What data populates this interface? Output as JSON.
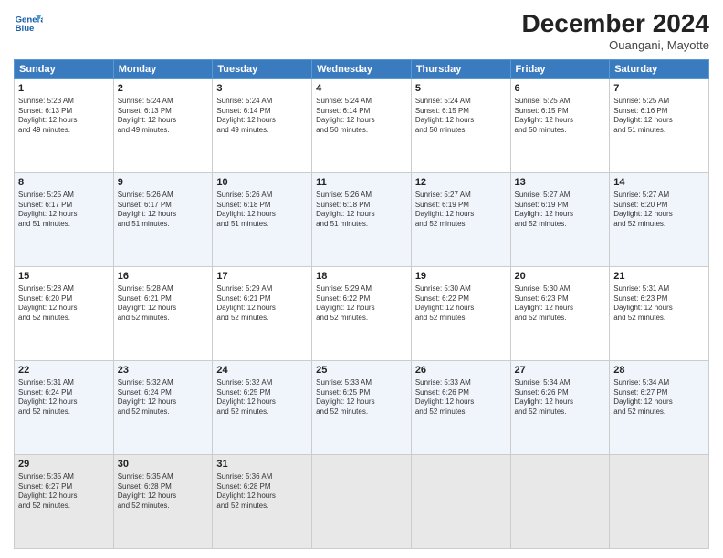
{
  "header": {
    "logo_line1": "General",
    "logo_line2": "Blue",
    "month": "December 2024",
    "location": "Ouangani, Mayotte"
  },
  "days_of_week": [
    "Sunday",
    "Monday",
    "Tuesday",
    "Wednesday",
    "Thursday",
    "Friday",
    "Saturday"
  ],
  "weeks": [
    [
      {
        "day": "1",
        "info": "Sunrise: 5:23 AM\nSunset: 6:13 PM\nDaylight: 12 hours\nand 49 minutes."
      },
      {
        "day": "2",
        "info": "Sunrise: 5:24 AM\nSunset: 6:13 PM\nDaylight: 12 hours\nand 49 minutes."
      },
      {
        "day": "3",
        "info": "Sunrise: 5:24 AM\nSunset: 6:14 PM\nDaylight: 12 hours\nand 49 minutes."
      },
      {
        "day": "4",
        "info": "Sunrise: 5:24 AM\nSunset: 6:14 PM\nDaylight: 12 hours\nand 50 minutes."
      },
      {
        "day": "5",
        "info": "Sunrise: 5:24 AM\nSunset: 6:15 PM\nDaylight: 12 hours\nand 50 minutes."
      },
      {
        "day": "6",
        "info": "Sunrise: 5:25 AM\nSunset: 6:15 PM\nDaylight: 12 hours\nand 50 minutes."
      },
      {
        "day": "7",
        "info": "Sunrise: 5:25 AM\nSunset: 6:16 PM\nDaylight: 12 hours\nand 51 minutes."
      }
    ],
    [
      {
        "day": "8",
        "info": "Sunrise: 5:25 AM\nSunset: 6:17 PM\nDaylight: 12 hours\nand 51 minutes."
      },
      {
        "day": "9",
        "info": "Sunrise: 5:26 AM\nSunset: 6:17 PM\nDaylight: 12 hours\nand 51 minutes."
      },
      {
        "day": "10",
        "info": "Sunrise: 5:26 AM\nSunset: 6:18 PM\nDaylight: 12 hours\nand 51 minutes."
      },
      {
        "day": "11",
        "info": "Sunrise: 5:26 AM\nSunset: 6:18 PM\nDaylight: 12 hours\nand 51 minutes."
      },
      {
        "day": "12",
        "info": "Sunrise: 5:27 AM\nSunset: 6:19 PM\nDaylight: 12 hours\nand 52 minutes."
      },
      {
        "day": "13",
        "info": "Sunrise: 5:27 AM\nSunset: 6:19 PM\nDaylight: 12 hours\nand 52 minutes."
      },
      {
        "day": "14",
        "info": "Sunrise: 5:27 AM\nSunset: 6:20 PM\nDaylight: 12 hours\nand 52 minutes."
      }
    ],
    [
      {
        "day": "15",
        "info": "Sunrise: 5:28 AM\nSunset: 6:20 PM\nDaylight: 12 hours\nand 52 minutes."
      },
      {
        "day": "16",
        "info": "Sunrise: 5:28 AM\nSunset: 6:21 PM\nDaylight: 12 hours\nand 52 minutes."
      },
      {
        "day": "17",
        "info": "Sunrise: 5:29 AM\nSunset: 6:21 PM\nDaylight: 12 hours\nand 52 minutes."
      },
      {
        "day": "18",
        "info": "Sunrise: 5:29 AM\nSunset: 6:22 PM\nDaylight: 12 hours\nand 52 minutes."
      },
      {
        "day": "19",
        "info": "Sunrise: 5:30 AM\nSunset: 6:22 PM\nDaylight: 12 hours\nand 52 minutes."
      },
      {
        "day": "20",
        "info": "Sunrise: 5:30 AM\nSunset: 6:23 PM\nDaylight: 12 hours\nand 52 minutes."
      },
      {
        "day": "21",
        "info": "Sunrise: 5:31 AM\nSunset: 6:23 PM\nDaylight: 12 hours\nand 52 minutes."
      }
    ],
    [
      {
        "day": "22",
        "info": "Sunrise: 5:31 AM\nSunset: 6:24 PM\nDaylight: 12 hours\nand 52 minutes."
      },
      {
        "day": "23",
        "info": "Sunrise: 5:32 AM\nSunset: 6:24 PM\nDaylight: 12 hours\nand 52 minutes."
      },
      {
        "day": "24",
        "info": "Sunrise: 5:32 AM\nSunset: 6:25 PM\nDaylight: 12 hours\nand 52 minutes."
      },
      {
        "day": "25",
        "info": "Sunrise: 5:33 AM\nSunset: 6:25 PM\nDaylight: 12 hours\nand 52 minutes."
      },
      {
        "day": "26",
        "info": "Sunrise: 5:33 AM\nSunset: 6:26 PM\nDaylight: 12 hours\nand 52 minutes."
      },
      {
        "day": "27",
        "info": "Sunrise: 5:34 AM\nSunset: 6:26 PM\nDaylight: 12 hours\nand 52 minutes."
      },
      {
        "day": "28",
        "info": "Sunrise: 5:34 AM\nSunset: 6:27 PM\nDaylight: 12 hours\nand 52 minutes."
      }
    ],
    [
      {
        "day": "29",
        "info": "Sunrise: 5:35 AM\nSunset: 6:27 PM\nDaylight: 12 hours\nand 52 minutes."
      },
      {
        "day": "30",
        "info": "Sunrise: 5:35 AM\nSunset: 6:28 PM\nDaylight: 12 hours\nand 52 minutes."
      },
      {
        "day": "31",
        "info": "Sunrise: 5:36 AM\nSunset: 6:28 PM\nDaylight: 12 hours\nand 52 minutes."
      },
      null,
      null,
      null,
      null
    ]
  ]
}
